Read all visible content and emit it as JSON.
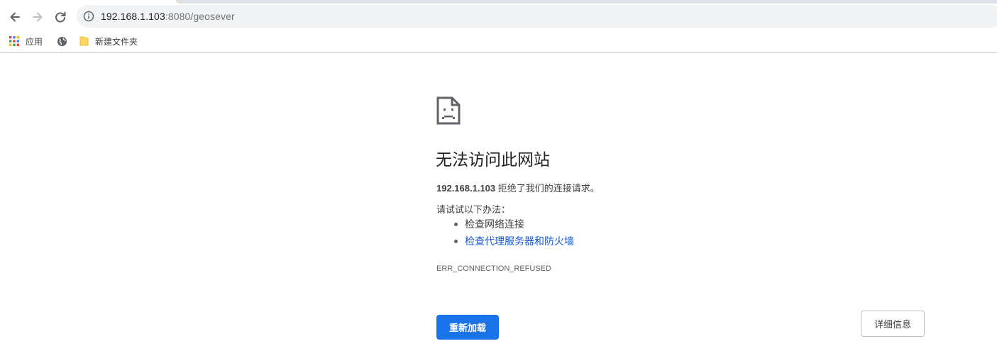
{
  "toolbar": {
    "url_host": "192.168.1.103",
    "url_rest": ":8080/geosever"
  },
  "bookmarks": {
    "apps_label": "应用",
    "folder_label": "新建文件夹"
  },
  "error": {
    "title": "无法访问此网站",
    "host": "192.168.1.103",
    "message": " 拒绝了我们的连接请求。",
    "hint": "请试试以下办法：",
    "suggestions": [
      {
        "label": "检查网络连接",
        "link": false
      },
      {
        "label": "检查代理服务器和防火墙",
        "link": true
      }
    ],
    "code": "ERR_CONNECTION_REFUSED",
    "reload_label": "重新加载",
    "details_label": "详细信息"
  },
  "colors": {
    "accent": "#1a73e8",
    "link": "#1558d6"
  }
}
